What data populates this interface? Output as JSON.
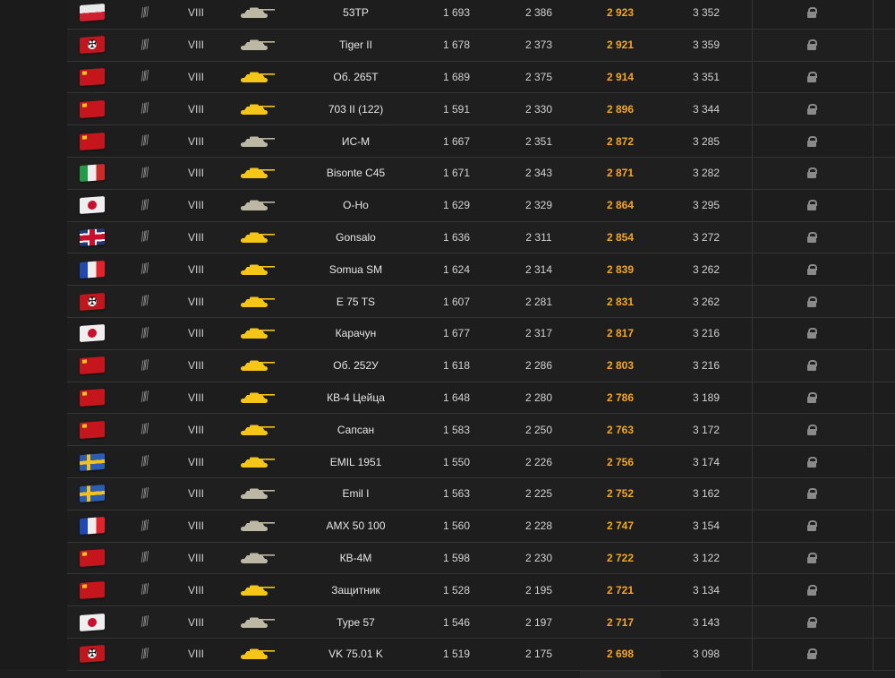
{
  "colors": {
    "accent": "#f5a623",
    "premium_tank": "#f5c518",
    "regular_tank": "#bdb8a4"
  },
  "rows": [
    {
      "flag": "poland",
      "tier": "VIII",
      "name": "53TP",
      "v1": "1 693",
      "v2": "2 386",
      "v3": "2 923",
      "v4": "3 352",
      "premium": false
    },
    {
      "flag": "germany",
      "tier": "VIII",
      "name": "Tiger II",
      "v1": "1 678",
      "v2": "2 373",
      "v3": "2 921",
      "v4": "3 359",
      "premium": false
    },
    {
      "flag": "ussr",
      "tier": "VIII",
      "name": "Об. 265Т",
      "v1": "1 689",
      "v2": "2 375",
      "v3": "2 914",
      "v4": "3 351",
      "premium": true
    },
    {
      "flag": "ussr",
      "tier": "VIII",
      "name": "703 II (122)",
      "v1": "1 591",
      "v2": "2 330",
      "v3": "2 896",
      "v4": "3 344",
      "premium": true
    },
    {
      "flag": "ussr",
      "tier": "VIII",
      "name": "ИС-М",
      "v1": "1 667",
      "v2": "2 351",
      "v3": "2 872",
      "v4": "3 285",
      "premium": false
    },
    {
      "flag": "italy",
      "tier": "VIII",
      "name": "Bisonte C45",
      "v1": "1 671",
      "v2": "2 343",
      "v3": "2 871",
      "v4": "3 282",
      "premium": true
    },
    {
      "flag": "japan",
      "tier": "VIII",
      "name": "O-Ho",
      "v1": "1 629",
      "v2": "2 329",
      "v3": "2 864",
      "v4": "3 295",
      "premium": false
    },
    {
      "flag": "uk",
      "tier": "VIII",
      "name": "Gonsalo",
      "v1": "1 636",
      "v2": "2 311",
      "v3": "2 854",
      "v4": "3 272",
      "premium": true
    },
    {
      "flag": "france",
      "tier": "VIII",
      "name": "Somua SM",
      "v1": "1 624",
      "v2": "2 314",
      "v3": "2 839",
      "v4": "3 262",
      "premium": true
    },
    {
      "flag": "germany",
      "tier": "VIII",
      "name": "E 75 TS",
      "v1": "1 607",
      "v2": "2 281",
      "v3": "2 831",
      "v4": "3 262",
      "premium": true
    },
    {
      "flag": "japan",
      "tier": "VIII",
      "name": "Карачун",
      "v1": "1 677",
      "v2": "2 317",
      "v3": "2 817",
      "v4": "3 216",
      "premium": true
    },
    {
      "flag": "ussr",
      "tier": "VIII",
      "name": "Об. 252У",
      "v1": "1 618",
      "v2": "2 286",
      "v3": "2 803",
      "v4": "3 216",
      "premium": true
    },
    {
      "flag": "ussr",
      "tier": "VIII",
      "name": "КВ-4 Цейца",
      "v1": "1 648",
      "v2": "2 280",
      "v3": "2 786",
      "v4": "3 189",
      "premium": true
    },
    {
      "flag": "ussr",
      "tier": "VIII",
      "name": "Сапсан",
      "v1": "1 583",
      "v2": "2 250",
      "v3": "2 763",
      "v4": "3 172",
      "premium": true
    },
    {
      "flag": "sweden",
      "tier": "VIII",
      "name": "EMIL 1951",
      "v1": "1 550",
      "v2": "2 226",
      "v3": "2 756",
      "v4": "3 174",
      "premium": true
    },
    {
      "flag": "sweden",
      "tier": "VIII",
      "name": "Emil I",
      "v1": "1 563",
      "v2": "2 225",
      "v3": "2 752",
      "v4": "3 162",
      "premium": false
    },
    {
      "flag": "france",
      "tier": "VIII",
      "name": "AMX 50 100",
      "v1": "1 560",
      "v2": "2 228",
      "v3": "2 747",
      "v4": "3 154",
      "premium": false
    },
    {
      "flag": "ussr",
      "tier": "VIII",
      "name": "КВ-4М",
      "v1": "1 598",
      "v2": "2 230",
      "v3": "2 722",
      "v4": "3 122",
      "premium": false
    },
    {
      "flag": "ussr",
      "tier": "VIII",
      "name": "Защитник",
      "v1": "1 528",
      "v2": "2 195",
      "v3": "2 721",
      "v4": "3 134",
      "premium": true
    },
    {
      "flag": "japan",
      "tier": "VIII",
      "name": "Type 57",
      "v1": "1 546",
      "v2": "2 197",
      "v3": "2 717",
      "v4": "3 143",
      "premium": false
    },
    {
      "flag": "germany",
      "tier": "VIII",
      "name": "VK 75.01 K",
      "v1": "1 519",
      "v2": "2 175",
      "v3": "2 698",
      "v4": "3 098",
      "premium": true
    }
  ]
}
